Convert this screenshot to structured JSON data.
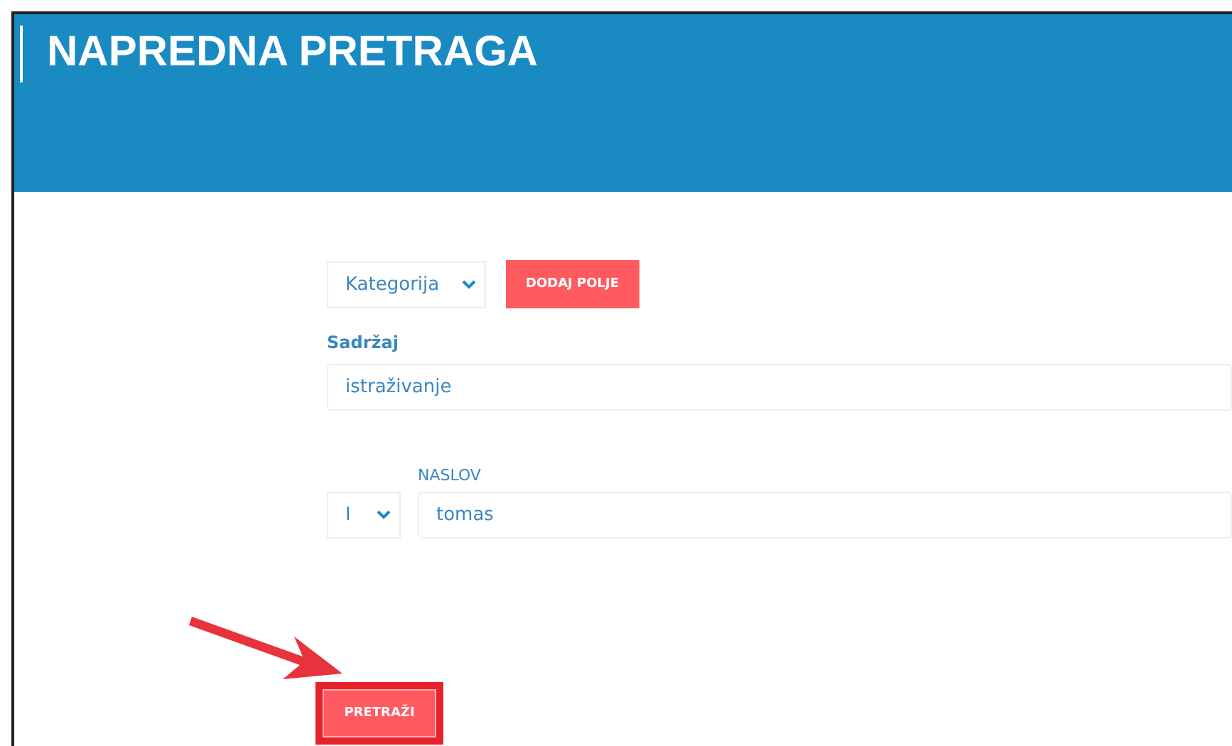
{
  "header": {
    "title": "NAPREDNA PRETRAGA"
  },
  "field_select": {
    "value": "Kategorija"
  },
  "add_field_button": "DODAJ POLJE",
  "content_field": {
    "label": "Sadržaj",
    "value": "istraživanje"
  },
  "title_field": {
    "operator": "I",
    "label": "NASLOV",
    "value": "tomas"
  },
  "search_button": "PRETRAŽI"
}
